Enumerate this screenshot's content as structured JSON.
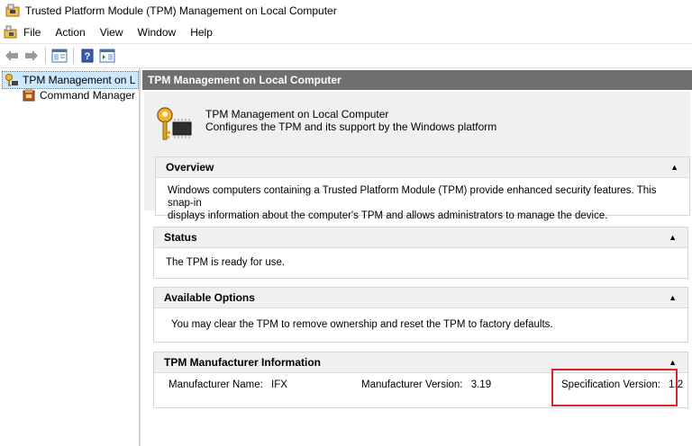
{
  "window": {
    "title": "Trusted Platform Module (TPM) Management on Local Computer"
  },
  "menu": {
    "items": [
      "File",
      "Action",
      "View",
      "Window",
      "Help"
    ]
  },
  "tree": {
    "items": [
      {
        "label": "TPM Management on L",
        "selected": true
      },
      {
        "label": "Command Manager",
        "selected": false
      }
    ]
  },
  "main": {
    "header": "TPM Management on Local Computer",
    "banner": {
      "title": "TPM Management on Local Computer",
      "description": "Configures the TPM and its support by the Windows platform"
    },
    "panels": {
      "overview": {
        "title": "Overview",
        "text_line1": "Windows computers containing a Trusted Platform Module (TPM) provide enhanced security features. This snap-in",
        "text_line2": "displays information about the computer's TPM and allows administrators to manage the device."
      },
      "status": {
        "title": "Status",
        "text": "The TPM is ready for use."
      },
      "options": {
        "title": "Available Options",
        "text": "You may clear the TPM to remove ownership and reset the TPM to factory defaults."
      },
      "manufacturer": {
        "title": "TPM Manufacturer Information",
        "name_label": "Manufacturer Name:",
        "name_value": "IFX",
        "version_label": "Manufacturer Version:",
        "version_value": "3.19",
        "spec_label": "Specification Version:",
        "spec_value": "1.2"
      }
    }
  },
  "colors": {
    "header_bg": "#6f6f6f",
    "selection_bg": "#cce8ff",
    "highlight": "#d6282b"
  }
}
